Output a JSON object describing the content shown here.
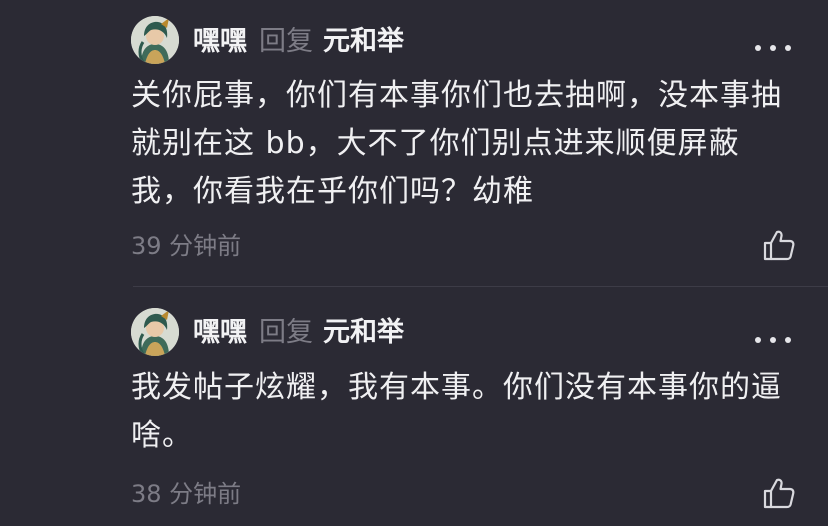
{
  "replies": [
    {
      "username": "嘿嘿",
      "reply_word": "回复",
      "reply_to": "元和举",
      "content_lines": [
        "关你屁事，你们有本事你们也去抽啊，没本事抽",
        "就别在这 bb，大不了你们别点进来顺便屏蔽",
        "我，你看我在乎你们吗？幼稚"
      ],
      "time": "39 分钟前",
      "more_icon": "more-dots-icon",
      "like_icon": "thumbs-up-icon"
    },
    {
      "username": "嘿嘿",
      "reply_word": "回复",
      "reply_to": "元和举",
      "content_lines": [
        "我发帖子炫耀，我有本事。你们没有本事你的逼",
        "啥。"
      ],
      "time": "38 分钟前",
      "more_icon": "more-dots-icon",
      "like_icon": "thumbs-up-icon"
    }
  ],
  "colors": {
    "background": "#2b2a34",
    "primary_text": "#f0f0f2",
    "secondary_text": "#7d7c86",
    "divider": "#3d3c47"
  }
}
